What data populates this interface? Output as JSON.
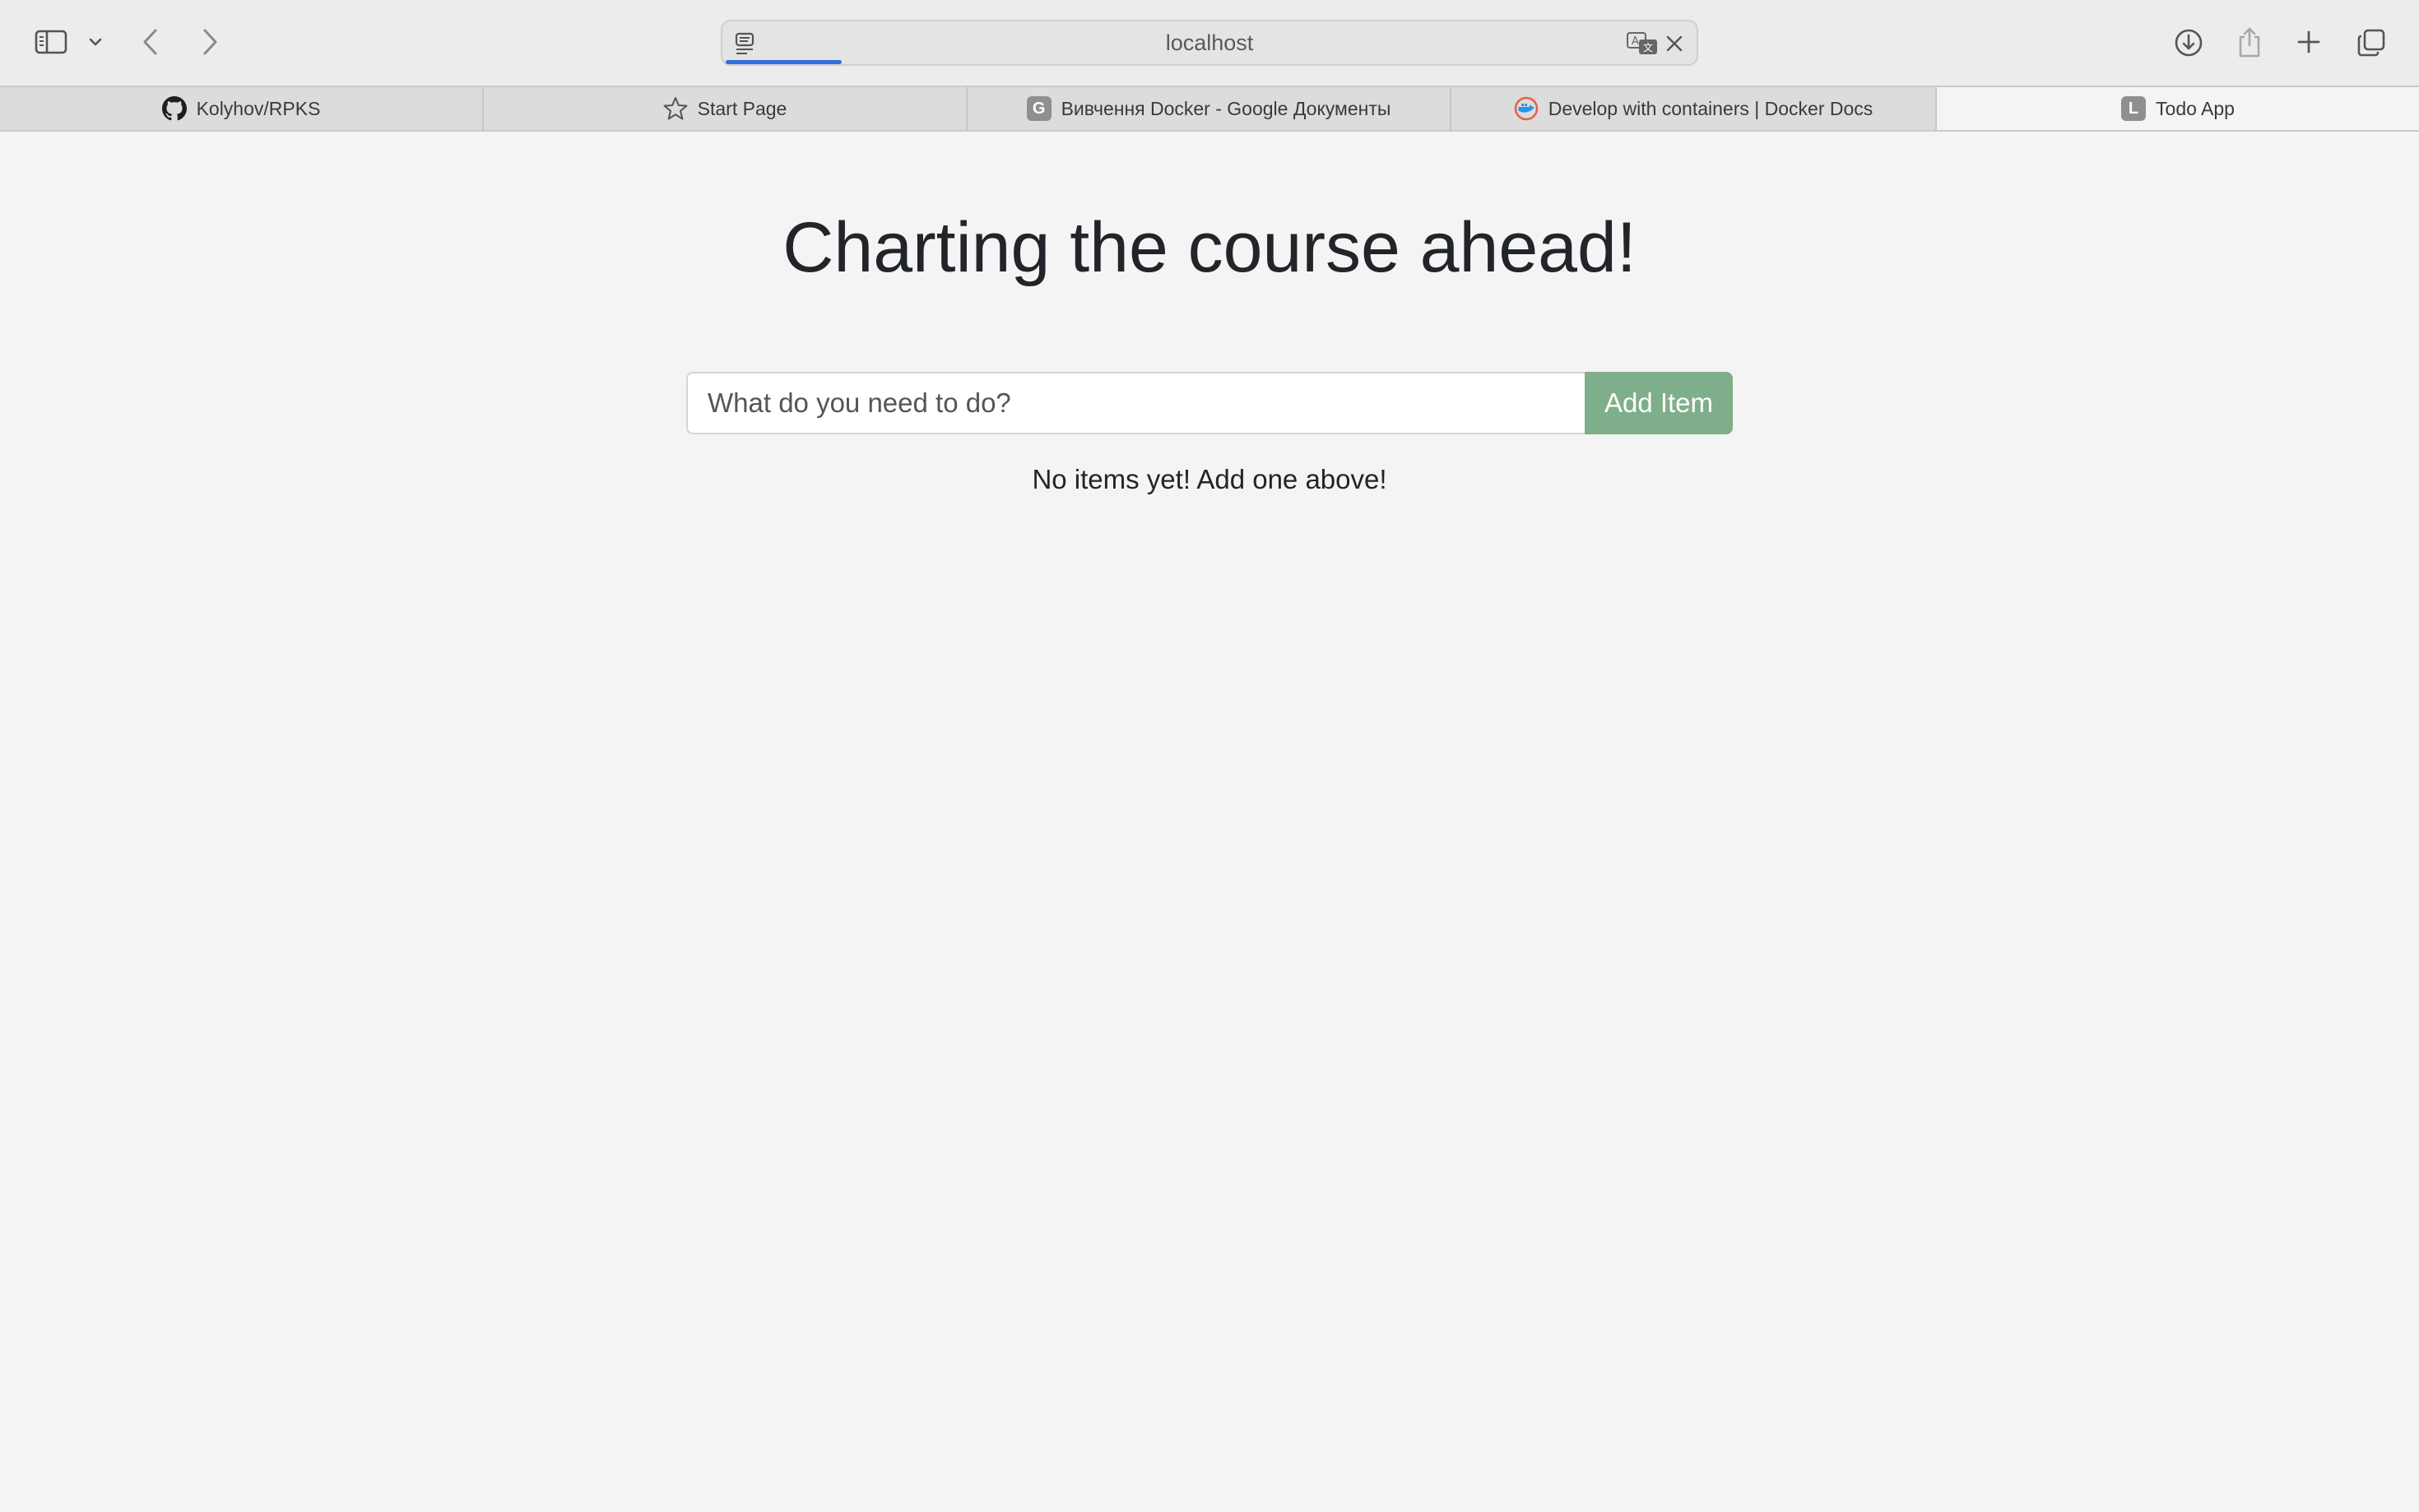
{
  "browser": {
    "url": "localhost",
    "loading_progress": 0.12,
    "toolbar_icons": [
      "sidebar-icon",
      "chevron-down-icon",
      "back-icon",
      "forward-icon",
      "reader-icon",
      "translate-icon",
      "close-icon",
      "download-icon",
      "share-icon",
      "new-tab-icon",
      "tab-overview-icon"
    ]
  },
  "tabs": [
    {
      "title": "Kolyhov/RPKS",
      "icon": "github-icon"
    },
    {
      "title": "Start Page",
      "icon": "star-icon"
    },
    {
      "title": "Вивчення Docker - Google Документы",
      "icon": "letter-g-icon",
      "icon_letter": "G"
    },
    {
      "title": "Develop with containers | Docker Docs",
      "icon": "docker-icon"
    },
    {
      "title": "Todo App",
      "icon": "letter-l-icon",
      "icon_letter": "L",
      "active": true
    }
  ],
  "page": {
    "title": "Charting the course ahead!",
    "input_placeholder": "What do you need to do?",
    "add_button_label": "Add Item",
    "empty_message": "No items yet! Add one above!",
    "accent_color": "#7fae8a"
  }
}
